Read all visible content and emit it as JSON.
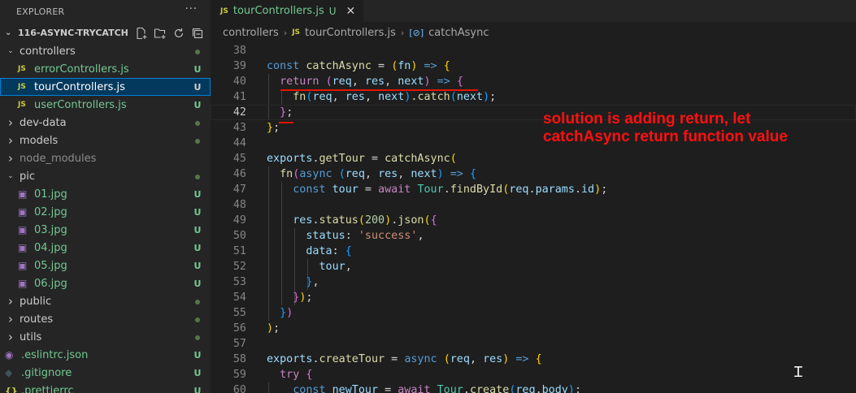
{
  "explorer": {
    "title": "EXPLORER",
    "more": "···",
    "project": "116-ASYNC-TRYCATCH",
    "items": [
      {
        "label": "controllers",
        "type": "folder",
        "open": true,
        "level": 1,
        "status": "dot"
      },
      {
        "label": "errorControllers.js",
        "type": "js",
        "level": 2,
        "status": "U"
      },
      {
        "label": "tourControllers.js",
        "type": "js",
        "level": 2,
        "status": "U",
        "selected": true
      },
      {
        "label": "userControllers.js",
        "type": "js",
        "level": 2,
        "status": "U"
      },
      {
        "label": "dev-data",
        "type": "folder",
        "open": false,
        "level": 1,
        "status": "dot"
      },
      {
        "label": "models",
        "type": "folder",
        "open": false,
        "level": 1,
        "status": "dot"
      },
      {
        "label": "node_modules",
        "type": "folder",
        "open": false,
        "level": 1,
        "status": "none",
        "dim": true
      },
      {
        "label": "pic",
        "type": "folder",
        "open": true,
        "level": 1,
        "status": "dot"
      },
      {
        "label": "01.jpg",
        "type": "img",
        "level": 2,
        "status": "U"
      },
      {
        "label": "02.jpg",
        "type": "img",
        "level": 2,
        "status": "U"
      },
      {
        "label": "03.jpg",
        "type": "img",
        "level": 2,
        "status": "U"
      },
      {
        "label": "04.jpg",
        "type": "img",
        "level": 2,
        "status": "U"
      },
      {
        "label": "05.jpg",
        "type": "img",
        "level": 2,
        "status": "U"
      },
      {
        "label": "06.jpg",
        "type": "img",
        "level": 2,
        "status": "U"
      },
      {
        "label": "public",
        "type": "folder",
        "open": false,
        "level": 1,
        "status": "dot"
      },
      {
        "label": "routes",
        "type": "folder",
        "open": false,
        "level": 1,
        "status": "dot"
      },
      {
        "label": "utils",
        "type": "folder",
        "open": false,
        "level": 1,
        "status": "dot"
      },
      {
        "label": ".eslintrc.json",
        "type": "eslint",
        "level": 1,
        "status": "U"
      },
      {
        "label": ".gitignore",
        "type": "git",
        "level": 1,
        "status": "U"
      },
      {
        "label": ".prettierrc",
        "type": "json",
        "level": 1,
        "status": "U"
      }
    ]
  },
  "tab": {
    "icon": "JS",
    "name": "tourControllers.js",
    "status": "U",
    "close": "✕"
  },
  "breadcrumb": {
    "folder": "controllers",
    "file": "tourControllers.js",
    "symbol": "catchAsync"
  },
  "annotation": {
    "line1": "solution is adding return, let",
    "line2": "catchAsync return function value",
    "color": "#ff1010"
  },
  "editor": {
    "current_line": 42,
    "lines": [
      {
        "n": 38,
        "tokens": []
      },
      {
        "n": 39,
        "tokens": [
          [
            "kw",
            "const"
          ],
          [
            "p",
            " "
          ],
          [
            "fn",
            "catchAsync"
          ],
          [
            "p",
            " = "
          ],
          [
            "br1",
            "("
          ],
          [
            "var",
            "fn"
          ],
          [
            "br1",
            ")"
          ],
          [
            "p",
            " "
          ],
          [
            "kw",
            "=>"
          ],
          [
            "p",
            " "
          ],
          [
            "br1",
            "{"
          ]
        ]
      },
      {
        "n": 40,
        "tokens": [
          [
            "p",
            "  "
          ],
          [
            "ctrl",
            "return"
          ],
          [
            "p",
            " "
          ],
          [
            "br2",
            "("
          ],
          [
            "var",
            "req"
          ],
          [
            "p",
            ", "
          ],
          [
            "var",
            "res"
          ],
          [
            "p",
            ", "
          ],
          [
            "var",
            "next"
          ],
          [
            "br2",
            ")"
          ],
          [
            "p",
            " "
          ],
          [
            "kw",
            "=>"
          ],
          [
            "p",
            " "
          ],
          [
            "br2",
            "{"
          ]
        ]
      },
      {
        "n": 41,
        "tokens": [
          [
            "p",
            "    "
          ],
          [
            "fn",
            "fn"
          ],
          [
            "br3",
            "("
          ],
          [
            "var",
            "req"
          ],
          [
            "p",
            ", "
          ],
          [
            "var",
            "res"
          ],
          [
            "p",
            ", "
          ],
          [
            "var",
            "next"
          ],
          [
            "br3",
            ")"
          ],
          [
            "p",
            "."
          ],
          [
            "fn",
            "catch"
          ],
          [
            "br3",
            "("
          ],
          [
            "var",
            "next"
          ],
          [
            "br3",
            ")"
          ],
          [
            "p",
            ";"
          ]
        ]
      },
      {
        "n": 42,
        "tokens": [
          [
            "p",
            "  "
          ],
          [
            "br2",
            "}"
          ],
          [
            "p",
            ";"
          ]
        ]
      },
      {
        "n": 43,
        "tokens": [
          [
            "br1",
            "}"
          ],
          [
            "p",
            ";"
          ]
        ]
      },
      {
        "n": 44,
        "tokens": []
      },
      {
        "n": 45,
        "tokens": [
          [
            "var",
            "exports"
          ],
          [
            "p",
            "."
          ],
          [
            "fn",
            "getTour"
          ],
          [
            "p",
            " = "
          ],
          [
            "fn",
            "catchAsync"
          ],
          [
            "br1",
            "("
          ]
        ]
      },
      {
        "n": 46,
        "tokens": [
          [
            "p",
            "  "
          ],
          [
            "fn",
            "fn"
          ],
          [
            "br2",
            "("
          ],
          [
            "kw",
            "async"
          ],
          [
            "p",
            " "
          ],
          [
            "br3",
            "("
          ],
          [
            "var",
            "req"
          ],
          [
            "p",
            ", "
          ],
          [
            "var",
            "res"
          ],
          [
            "p",
            ", "
          ],
          [
            "var",
            "next"
          ],
          [
            "br3",
            ")"
          ],
          [
            "p",
            " "
          ],
          [
            "kw",
            "=>"
          ],
          [
            "p",
            " "
          ],
          [
            "br3",
            "{"
          ]
        ]
      },
      {
        "n": 47,
        "tokens": [
          [
            "p",
            "    "
          ],
          [
            "kw",
            "const"
          ],
          [
            "p",
            " "
          ],
          [
            "var",
            "tour"
          ],
          [
            "p",
            " = "
          ],
          [
            "ctrl",
            "await"
          ],
          [
            "p",
            " "
          ],
          [
            "cls",
            "Tour"
          ],
          [
            "p",
            "."
          ],
          [
            "fn",
            "findById"
          ],
          [
            "br1",
            "("
          ],
          [
            "var",
            "req"
          ],
          [
            "p",
            "."
          ],
          [
            "var",
            "params"
          ],
          [
            "p",
            "."
          ],
          [
            "var",
            "id"
          ],
          [
            "br1",
            ")"
          ],
          [
            "p",
            ";"
          ]
        ]
      },
      {
        "n": 48,
        "tokens": []
      },
      {
        "n": 49,
        "tokens": [
          [
            "p",
            "    "
          ],
          [
            "var",
            "res"
          ],
          [
            "p",
            "."
          ],
          [
            "fn",
            "status"
          ],
          [
            "br1",
            "("
          ],
          [
            "num",
            "200"
          ],
          [
            "br1",
            ")"
          ],
          [
            "p",
            "."
          ],
          [
            "fn",
            "json"
          ],
          [
            "br1",
            "("
          ],
          [
            "br2",
            "{"
          ]
        ]
      },
      {
        "n": 50,
        "tokens": [
          [
            "p",
            "      "
          ],
          [
            "var",
            "status"
          ],
          [
            "p",
            ": "
          ],
          [
            "str",
            "'success'"
          ],
          [
            "p",
            ","
          ]
        ]
      },
      {
        "n": 51,
        "tokens": [
          [
            "p",
            "      "
          ],
          [
            "var",
            "data"
          ],
          [
            "p",
            ": "
          ],
          [
            "br3",
            "{"
          ]
        ]
      },
      {
        "n": 52,
        "tokens": [
          [
            "p",
            "        "
          ],
          [
            "var",
            "tour"
          ],
          [
            "p",
            ","
          ]
        ]
      },
      {
        "n": 53,
        "tokens": [
          [
            "p",
            "      "
          ],
          [
            "br3",
            "}"
          ],
          [
            "p",
            ","
          ]
        ]
      },
      {
        "n": 54,
        "tokens": [
          [
            "p",
            "    "
          ],
          [
            "br2",
            "}"
          ],
          [
            "br1",
            ")"
          ],
          [
            "p",
            ";"
          ]
        ]
      },
      {
        "n": 55,
        "tokens": [
          [
            "p",
            "  "
          ],
          [
            "br3",
            "}"
          ],
          [
            "br2",
            ")"
          ]
        ]
      },
      {
        "n": 56,
        "tokens": [
          [
            "br1",
            ")"
          ],
          [
            "p",
            ";"
          ]
        ]
      },
      {
        "n": 57,
        "tokens": []
      },
      {
        "n": 58,
        "tokens": [
          [
            "var",
            "exports"
          ],
          [
            "p",
            "."
          ],
          [
            "fn",
            "createTour"
          ],
          [
            "p",
            " = "
          ],
          [
            "kw",
            "async"
          ],
          [
            "p",
            " "
          ],
          [
            "br1",
            "("
          ],
          [
            "var",
            "req"
          ],
          [
            "p",
            ", "
          ],
          [
            "var",
            "res"
          ],
          [
            "br1",
            ")"
          ],
          [
            "p",
            " "
          ],
          [
            "kw",
            "=>"
          ],
          [
            "p",
            " "
          ],
          [
            "br1",
            "{"
          ]
        ]
      },
      {
        "n": 59,
        "tokens": [
          [
            "p",
            "  "
          ],
          [
            "ctrl",
            "try"
          ],
          [
            "p",
            " "
          ],
          [
            "br2",
            "{"
          ]
        ]
      },
      {
        "n": 60,
        "tokens": [
          [
            "p",
            "    "
          ],
          [
            "kw",
            "const"
          ],
          [
            "p",
            " "
          ],
          [
            "var",
            "newTour"
          ],
          [
            "p",
            " = "
          ],
          [
            "ctrl",
            "await"
          ],
          [
            "p",
            " "
          ],
          [
            "cls",
            "Tour"
          ],
          [
            "p",
            "."
          ],
          [
            "fn",
            "create"
          ],
          [
            "br3",
            "("
          ],
          [
            "var",
            "req"
          ],
          [
            "p",
            "."
          ],
          [
            "var",
            "body"
          ],
          [
            "br3",
            ")"
          ],
          [
            "p",
            ";"
          ]
        ]
      }
    ]
  }
}
